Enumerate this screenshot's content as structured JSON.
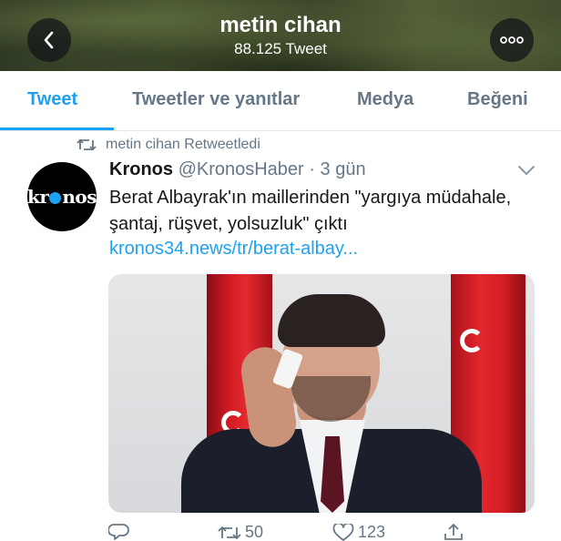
{
  "header": {
    "name": "metin cihan",
    "tweet_count": "88.125 Tweet",
    "icons": {
      "back": "chevron-left-icon",
      "more": "more-horizontal-icon"
    }
  },
  "tabs": [
    {
      "label": "Tweet",
      "active": true
    },
    {
      "label": "Tweetler ve yanıtlar",
      "active": false
    },
    {
      "label": "Medya",
      "active": false
    },
    {
      "label": "Beğeni",
      "active": false
    }
  ],
  "tweet": {
    "retweeted_by": "metin cihan Retweetledi",
    "avatar_text_left": "kr",
    "avatar_text_right": "nos",
    "author_name": "Kronos",
    "author_handle": "@KronosHaber",
    "separator": "·",
    "time": "3 gün",
    "text": "Berat Albayrak'ın maillerinden \"yargıya müdahale, şantaj, rüşvet, yolsuzluk\" çıktı",
    "link": "kronos34.news/tr/berat-albay...",
    "retweet_count": "50",
    "like_count": "123"
  },
  "colors": {
    "accent": "#1da1f2",
    "muted": "#657786",
    "text": "#14171a"
  }
}
